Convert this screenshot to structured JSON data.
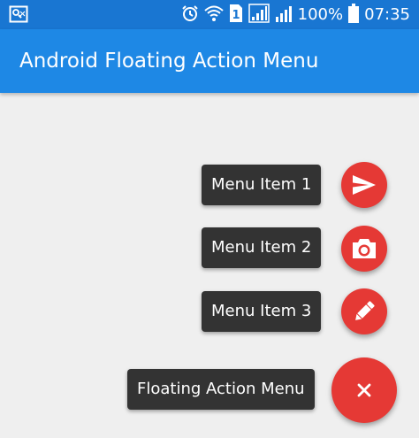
{
  "status_bar": {
    "battery_percent": "100%",
    "time": "07:35",
    "icons": [
      "screenshot-icon",
      "alarm-icon",
      "wifi-icon",
      "sim-icon",
      "signal-icon",
      "signal-icon",
      "battery-icon"
    ]
  },
  "app_bar": {
    "title": "Android Floating Action Menu"
  },
  "menu": {
    "items": [
      {
        "label": "Menu Item 1",
        "icon": "send-icon"
      },
      {
        "label": "Menu Item 2",
        "icon": "camera-icon"
      },
      {
        "label": "Menu Item 3",
        "icon": "pencil-icon"
      }
    ],
    "main_label": "Floating Action Menu",
    "main_icon": "close-icon"
  },
  "colors": {
    "primary_dark": "#1976d2",
    "primary": "#1e88e5",
    "fab": "#e53935",
    "label_bg": "#333333",
    "background": "#efefef"
  }
}
